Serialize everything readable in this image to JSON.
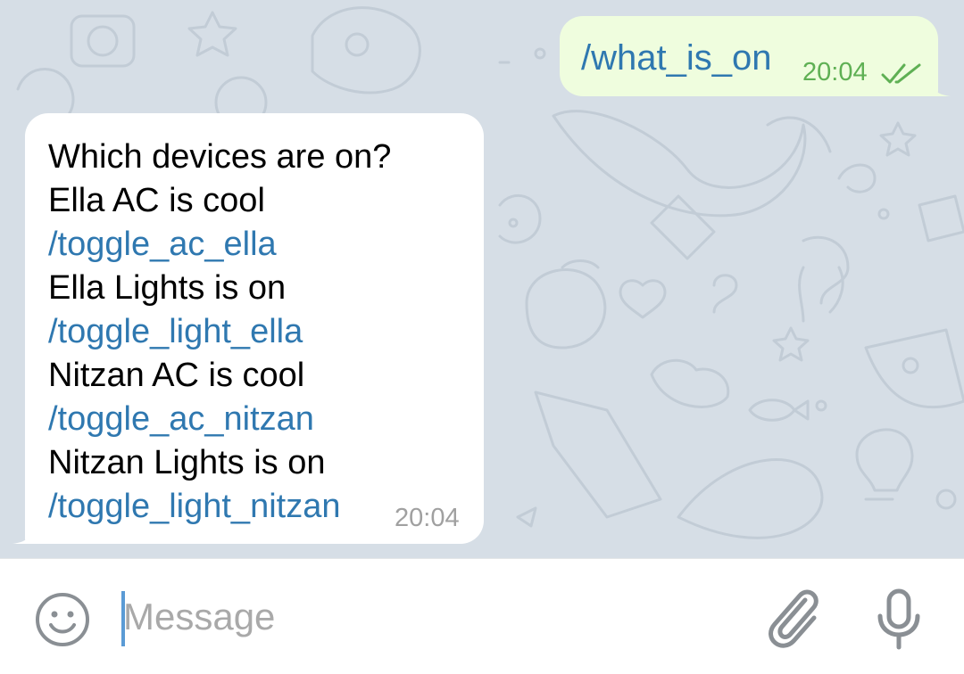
{
  "theme": {
    "chat_background": "#d6dee6",
    "outgoing_bubble": "#effdde",
    "incoming_bubble": "#ffffff",
    "command_link": "#2f78b0",
    "outgoing_time": "#5fb054",
    "incoming_time": "#a0a0a0"
  },
  "messages": {
    "outgoing": {
      "text": "/what_is_on",
      "time": "20:04",
      "status_icon": "double-check-icon"
    },
    "incoming": {
      "lines": [
        {
          "text": "Which devices are on?",
          "kind": "text"
        },
        {
          "text": "Ella AC is cool",
          "kind": "text"
        },
        {
          "text": "/toggle_ac_ella",
          "kind": "command"
        },
        {
          "text": "Ella Lights is on",
          "kind": "text"
        },
        {
          "text": "/toggle_light_ella",
          "kind": "command"
        },
        {
          "text": "Nitzan AC is cool",
          "kind": "text"
        },
        {
          "text": "/toggle_ac_nitzan",
          "kind": "command"
        },
        {
          "text": "Nitzan Lights is on",
          "kind": "text"
        },
        {
          "text": "/toggle_light_nitzan",
          "kind": "command"
        }
      ],
      "time": "20:04"
    }
  },
  "composer": {
    "placeholder": "Message",
    "value": "",
    "icons": [
      "emoji-icon",
      "attach-icon",
      "microphone-icon"
    ]
  }
}
